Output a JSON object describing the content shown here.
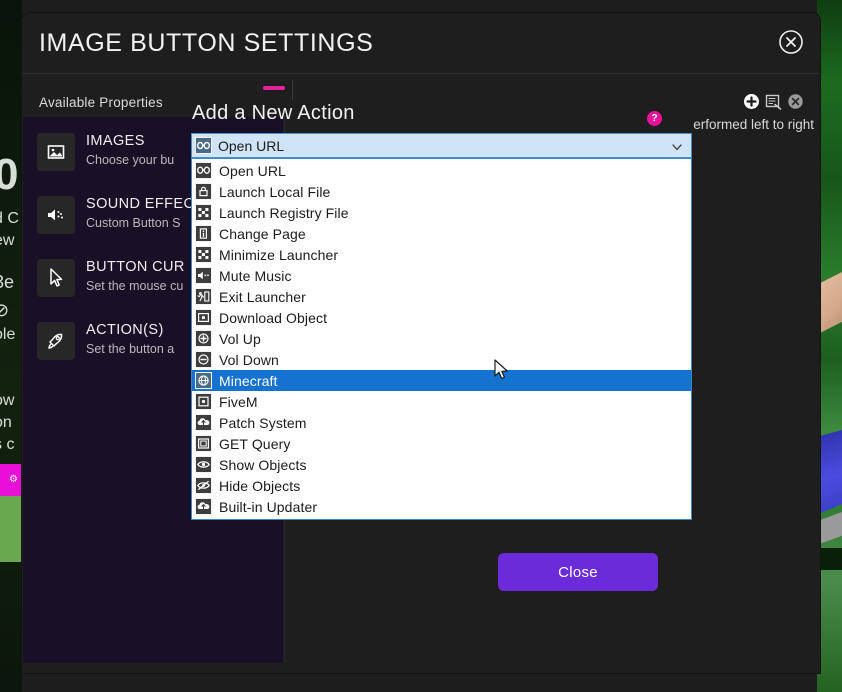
{
  "window": {
    "title": "IMAGE BUTTON SETTINGS",
    "close_icon": "circle-x-icon"
  },
  "properties_panel": {
    "label": "Available Properties",
    "items": [
      {
        "icon": "image-icon",
        "title": "IMAGES",
        "subtitle": "Choose your bu"
      },
      {
        "icon": "speaker-icon",
        "title": "SOUND EFFEC",
        "subtitle": "Custom Button S"
      },
      {
        "icon": "cursor-icon",
        "title": "BUTTON CUR",
        "subtitle": "Set the mouse cu"
      },
      {
        "icon": "rocket-icon",
        "title": "ACTION(S)",
        "subtitle": "Set the button a"
      }
    ]
  },
  "order_hint": "erformed left to right",
  "toolbar": {
    "icons": [
      {
        "name": "add-icon"
      },
      {
        "name": "edit-list-icon"
      },
      {
        "name": "delete-icon"
      }
    ]
  },
  "action_card": {
    "heading": "Add a New Action",
    "help_badge": "?",
    "combo": {
      "selected": "Open URL",
      "icon": "link-icon",
      "arrow_icon": "chevron-down-icon"
    },
    "options": [
      {
        "label": "Open URL",
        "icon": "link-icon",
        "selected": false
      },
      {
        "label": "Launch Local File",
        "icon": "lock-file-icon",
        "selected": false
      },
      {
        "label": "Launch Registry File",
        "icon": "registry-icon",
        "selected": false
      },
      {
        "label": "Change Page",
        "icon": "info-page-icon",
        "selected": false
      },
      {
        "label": "Minimize Launcher",
        "icon": "registry-icon",
        "selected": false
      },
      {
        "label": "Mute Music",
        "icon": "speaker-mute-icon",
        "selected": false
      },
      {
        "label": "Exit Launcher",
        "icon": "exit-run-icon",
        "selected": false
      },
      {
        "label": "Download Object",
        "icon": "download-icon",
        "selected": false
      },
      {
        "label": "Vol Up",
        "icon": "plus-circle-icon",
        "selected": false
      },
      {
        "label": "Vol Down",
        "icon": "minus-circle-icon",
        "selected": false
      },
      {
        "label": "Minecraft",
        "icon": "globe-icon",
        "selected": true
      },
      {
        "label": "FiveM",
        "icon": "dot-square-icon",
        "selected": false
      },
      {
        "label": "Patch System",
        "icon": "cloud-up-icon",
        "selected": false
      },
      {
        "label": "GET Query",
        "icon": "frame-icon",
        "selected": false
      },
      {
        "label": "Show Objects",
        "icon": "eye-icon",
        "selected": false
      },
      {
        "label": "Hide Objects",
        "icon": "eye-off-icon",
        "selected": false
      },
      {
        "label": "Built-in Updater",
        "icon": "cloud-up-icon",
        "selected": false
      }
    ]
  },
  "close_button": {
    "label": "Close"
  },
  "colors": {
    "accent_purple": "#6c2bd9",
    "accent_pink": "#e8119b",
    "selection_blue": "#1572cf",
    "combo_blue": "#cfe4f7",
    "panel_purple": "#190f26",
    "window_bg": "#1e1e1e"
  },
  "background": {
    "left_strip": {
      "big": "0",
      "lines": [
        "d C",
        "ew",
        "3e",
        "⊘",
        "ole",
        "ow",
        "on",
        "s c"
      ]
    }
  }
}
